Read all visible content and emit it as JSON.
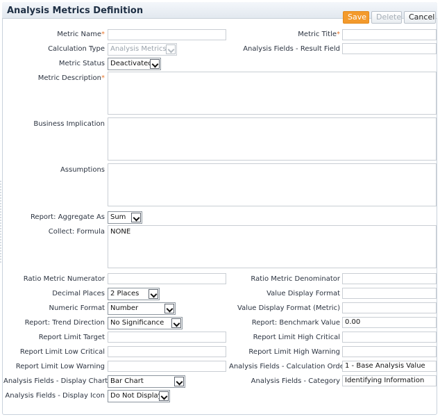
{
  "header": {
    "title": "Analysis Metrics Definition",
    "save": "Save",
    "delete": "Delete",
    "cancel": "Cancel"
  },
  "fields": {
    "metric_name": {
      "label": "Metric Name",
      "required_mark": "*",
      "value": ""
    },
    "metric_title": {
      "label": "Metric Title",
      "required_mark": "*",
      "value": ""
    },
    "calculation_type": {
      "label": "Calculation Type",
      "value": "Analysis Metrics"
    },
    "result_field": {
      "label": "Analysis Fields - Result Field",
      "value": ""
    },
    "metric_status": {
      "label": "Metric Status",
      "value": "Deactivated"
    },
    "metric_description": {
      "label": "Metric Description",
      "required_mark": "*",
      "value": ""
    },
    "business_implication": {
      "label": "Business Implication",
      "value": ""
    },
    "assumptions": {
      "label": "Assumptions",
      "value": ""
    },
    "aggregate_as": {
      "label": "Report: Aggregate As",
      "value": "Sum"
    },
    "collect_formula": {
      "label": "Collect: Formula",
      "value": "NONE"
    },
    "ratio_numerator": {
      "label": "Ratio Metric Numerator",
      "value": ""
    },
    "ratio_denominator": {
      "label": "Ratio Metric Denominator",
      "value": ""
    },
    "decimal_places": {
      "label": "Decimal Places",
      "value": "2 Places"
    },
    "value_display_format": {
      "label": "Value Display Format",
      "value": ""
    },
    "numeric_format": {
      "label": "Numeric Format",
      "value": "Number"
    },
    "value_display_format_metric": {
      "label": "Value Display Format (Metric)",
      "value": ""
    },
    "trend_direction": {
      "label": "Report: Trend Direction",
      "value": "No Significance"
    },
    "benchmark_value": {
      "label": "Report: Benchmark Value",
      "value": "0.00"
    },
    "limit_target": {
      "label": "Report Limit Target",
      "value": ""
    },
    "limit_high_critical": {
      "label": "Report Limit High Critical",
      "value": ""
    },
    "limit_low_critical": {
      "label": "Report Limit Low Critical",
      "value": ""
    },
    "limit_high_warning": {
      "label": "Report Limit High Warning",
      "value": ""
    },
    "limit_low_warning": {
      "label": "Report Limit Low Warning",
      "value": ""
    },
    "calculation_order": {
      "label": "Analysis Fields - Calculation Order",
      "value": "1 - Base Analysis Value"
    },
    "display_chart": {
      "label": "Analysis Fields - Display Chart",
      "value": "Bar Chart"
    },
    "category": {
      "label": "Analysis Fields - Category",
      "value": "Identifying Information"
    },
    "display_icon": {
      "label": "Analysis Fields - Display Icon",
      "value": "Do Not Display"
    }
  },
  "colors": {
    "accent": "#f39a2c",
    "title_text": "#1e2f44",
    "required": "#e8772e"
  }
}
